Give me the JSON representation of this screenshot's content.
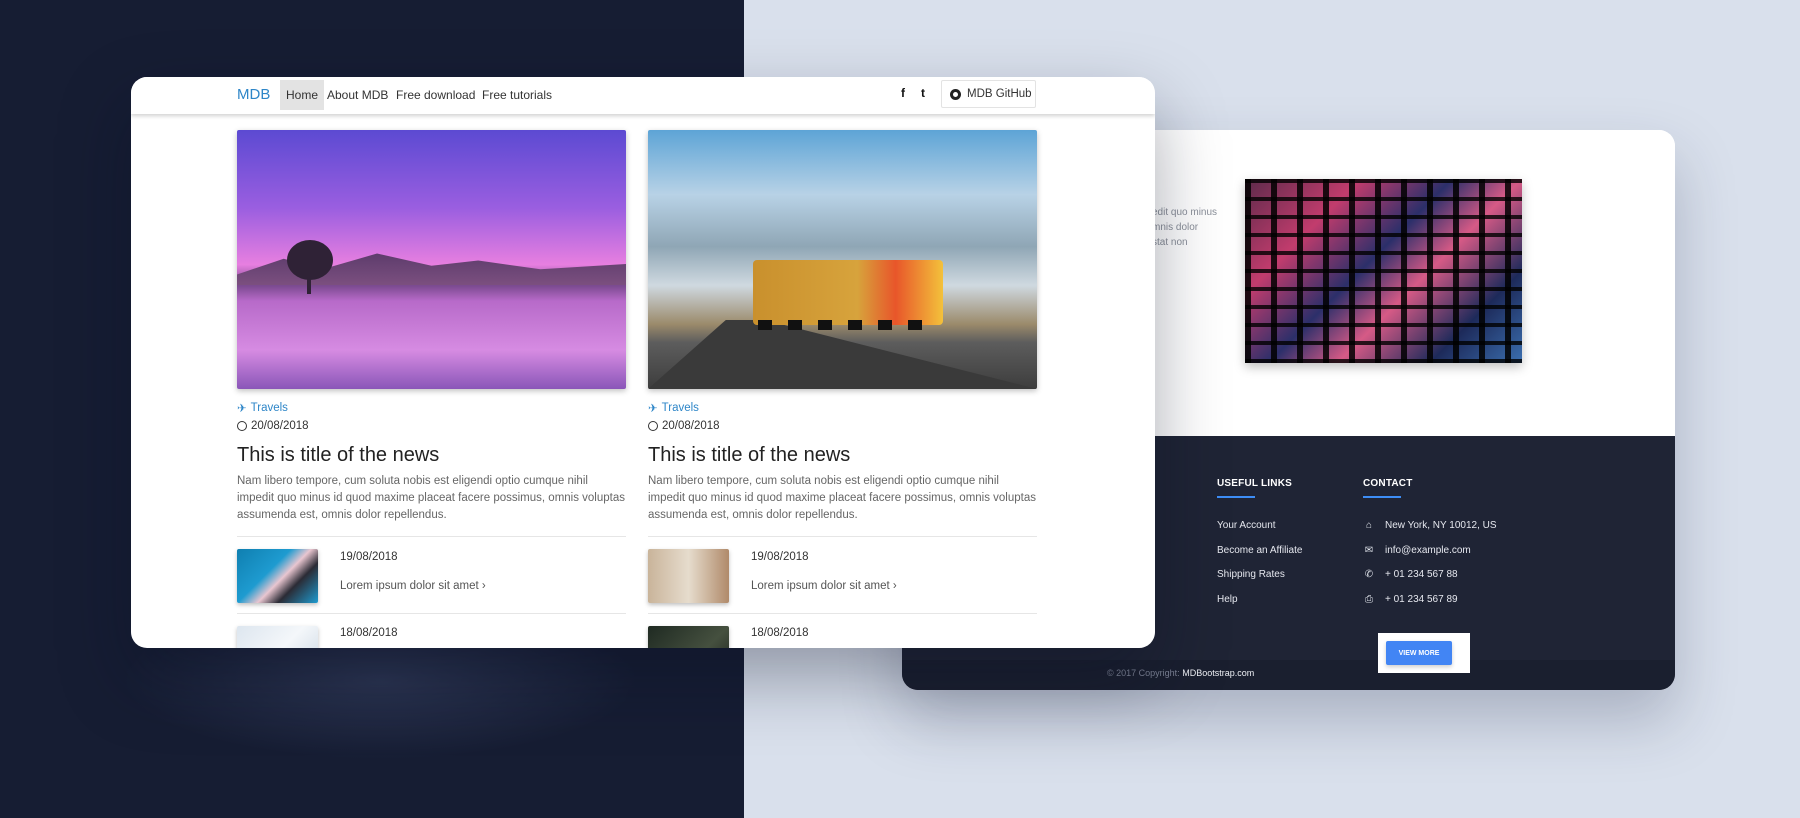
{
  "front": {
    "nav": {
      "brand": "MDB",
      "items": [
        {
          "label": "Home",
          "active": true
        },
        {
          "label": "About MDB",
          "active": false
        },
        {
          "label": "Free download",
          "active": false
        },
        {
          "label": "Free tutorials",
          "active": false
        }
      ],
      "social": {
        "facebook": "f",
        "twitter": "t"
      },
      "github_label": "MDB GitHub"
    },
    "cards": [
      {
        "category": "Travels",
        "date": "20/08/2018",
        "title": "This is title of the news",
        "excerpt": "Nam libero tempore, cum soluta nobis est eligendi optio cumque nihil impedit quo minus id quod maxime placeat facere possimus, omnis voluptas assumenda est, omnis dolor repellendus.",
        "related": [
          {
            "date": "19/08/2018",
            "link": "Lorem ipsum dolor sit amet ›"
          },
          {
            "date": "18/08/2018"
          }
        ]
      },
      {
        "category": "Travels",
        "date": "20/08/2018",
        "title": "This is title of the news",
        "excerpt": "Nam libero tempore, cum soluta nobis est eligendi optio cumque nihil impedit quo minus id quod maxime placeat facere possimus, omnis voluptas assumenda est, omnis dolor repellendus.",
        "related": [
          {
            "date": "19/08/2018",
            "link": "Lorem ipsum dolor sit amet ›"
          },
          {
            "date": "18/08/2018"
          }
        ]
      }
    ]
  },
  "back": {
    "partial_text": [
      "edit quo minus",
      "mnis dolor",
      "stat non"
    ],
    "footer": {
      "useful_links": {
        "heading": "USEFUL LINKS",
        "items": [
          "Your Account",
          "Become an Affiliate",
          "Shipping Rates",
          "Help"
        ]
      },
      "contact": {
        "heading": "CONTACT",
        "items": [
          {
            "icon": "home-icon",
            "text": "New York, NY 10012, US"
          },
          {
            "icon": "envelope-icon",
            "text": "info@example.com"
          },
          {
            "icon": "phone-icon",
            "text": "+ 01 234 567 88"
          },
          {
            "icon": "print-icon",
            "text": "+ 01 234 567 89"
          }
        ]
      },
      "view_more": "VIEW MORE",
      "copyright_prefix": "© 2017 Copyright:",
      "copyright_link": "MDBootstrap.com"
    }
  },
  "colors": {
    "accent": "#2e86c8",
    "button": "#4285f4",
    "footer_bg": "#1f2435",
    "left_bg": "#161d33",
    "right_bg": "#d9e0ec"
  }
}
